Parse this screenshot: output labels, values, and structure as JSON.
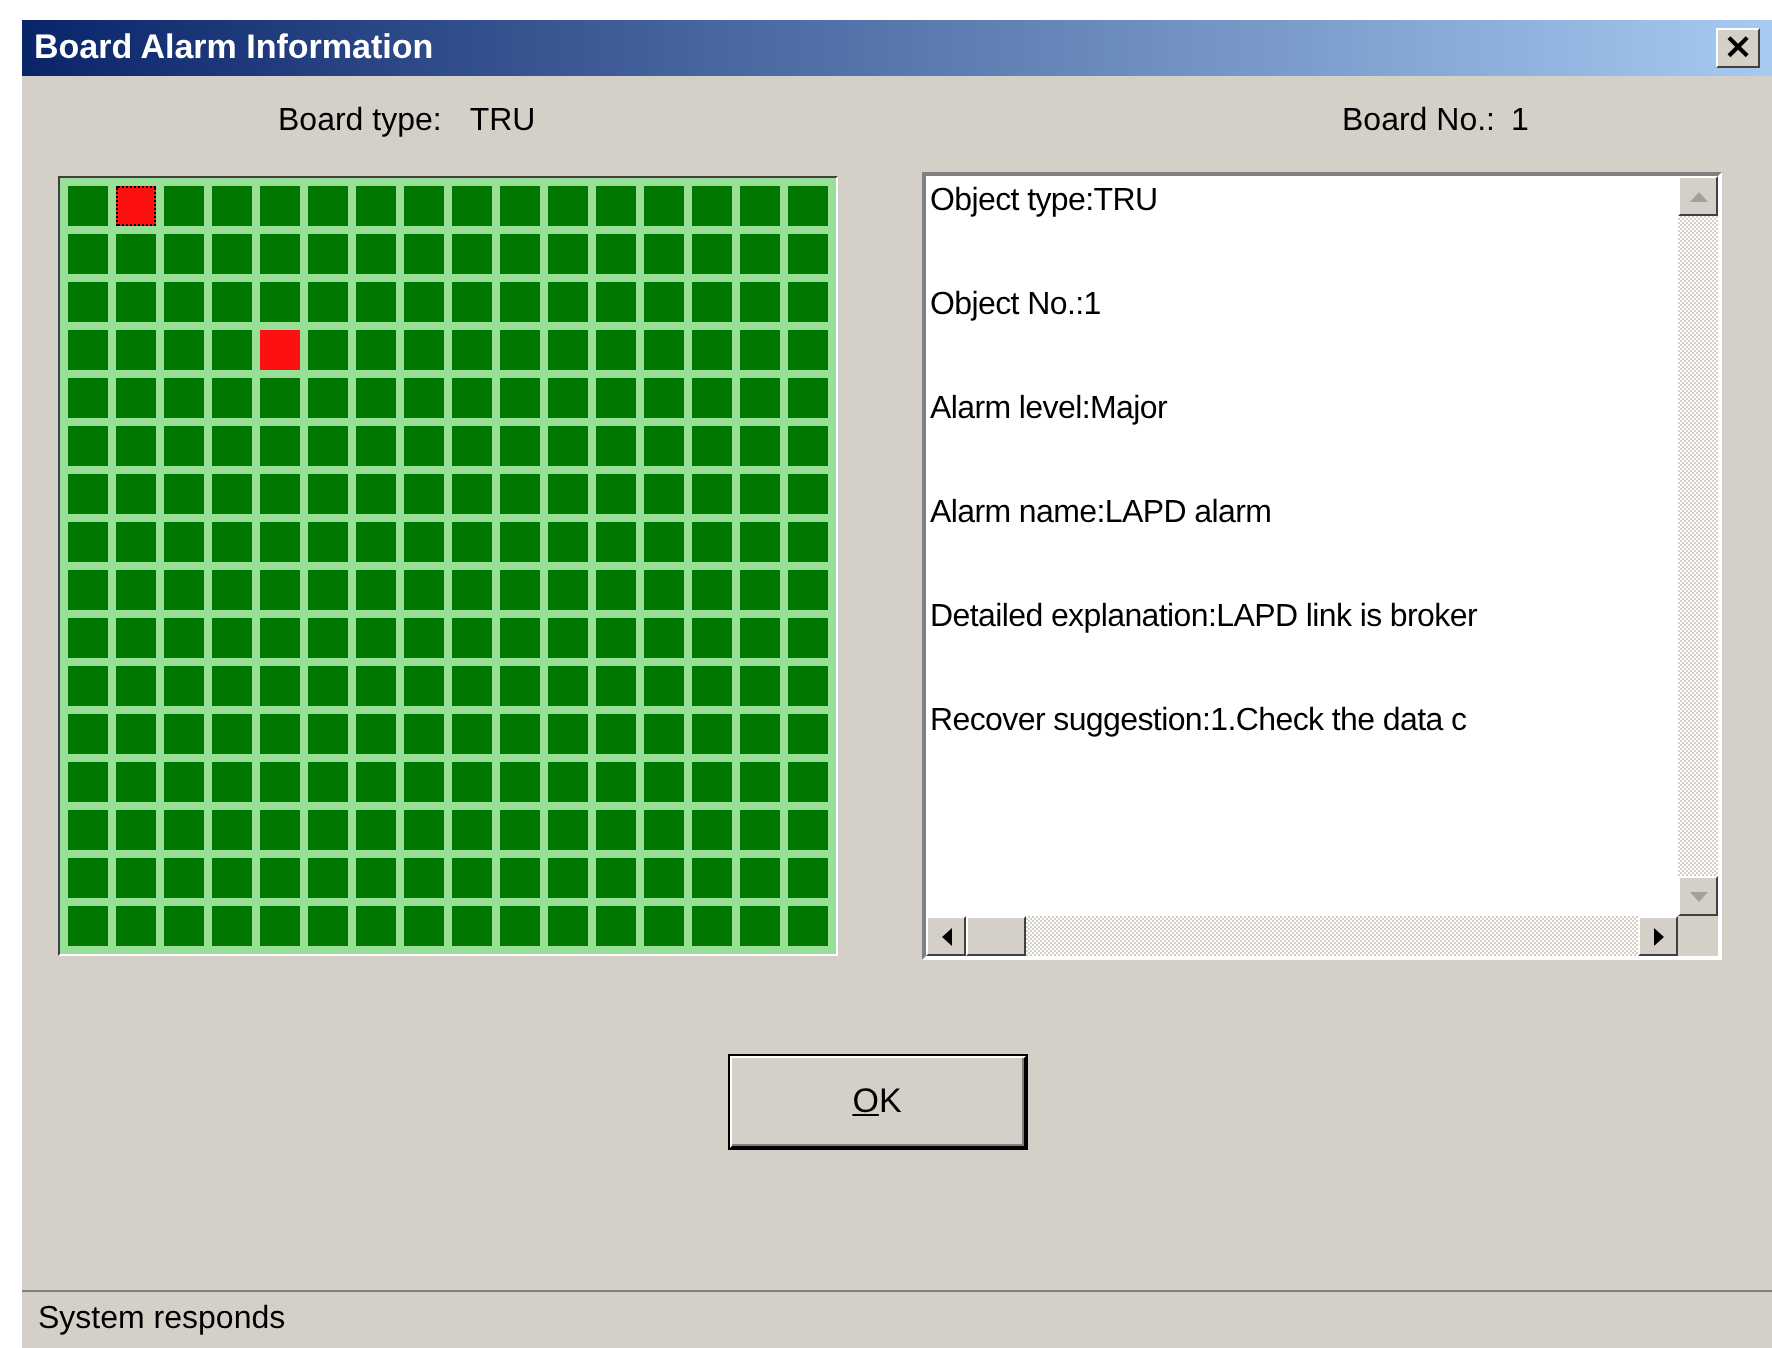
{
  "window": {
    "title": "Board Alarm Information",
    "close": "×"
  },
  "header": {
    "board_type_label": "Board type:",
    "board_type": "TRU",
    "board_no_label": "Board No.:",
    "board_no": "1"
  },
  "board_grid": {
    "rows": [
      {
        "cells": [
          {
            "alarm": false,
            "selected": false
          },
          {
            "alarm": true,
            "selected": true
          },
          {
            "alarm": false,
            "selected": false
          },
          {
            "alarm": false,
            "selected": false
          },
          {
            "alarm": false,
            "selected": false
          },
          {
            "alarm": false,
            "selected": false
          },
          {
            "alarm": false,
            "selected": false
          },
          {
            "alarm": false,
            "selected": false
          },
          {
            "alarm": false,
            "selected": false
          },
          {
            "alarm": false,
            "selected": false
          },
          {
            "alarm": false,
            "selected": false
          },
          {
            "alarm": false,
            "selected": false
          },
          {
            "alarm": false,
            "selected": false
          },
          {
            "alarm": false,
            "selected": false
          },
          {
            "alarm": false,
            "selected": false
          },
          {
            "alarm": false,
            "selected": false
          }
        ]
      },
      {
        "cells": [
          {
            "alarm": false,
            "selected": false
          },
          {
            "alarm": false,
            "selected": false
          },
          {
            "alarm": false,
            "selected": false
          },
          {
            "alarm": false,
            "selected": false
          },
          {
            "alarm": false,
            "selected": false
          },
          {
            "alarm": false,
            "selected": false
          },
          {
            "alarm": false,
            "selected": false
          },
          {
            "alarm": false,
            "selected": false
          },
          {
            "alarm": false,
            "selected": false
          },
          {
            "alarm": false,
            "selected": false
          },
          {
            "alarm": false,
            "selected": false
          },
          {
            "alarm": false,
            "selected": false
          },
          {
            "alarm": false,
            "selected": false
          },
          {
            "alarm": false,
            "selected": false
          },
          {
            "alarm": false,
            "selected": false
          },
          {
            "alarm": false,
            "selected": false
          }
        ]
      },
      {
        "cells": [
          {
            "alarm": false,
            "selected": false
          },
          {
            "alarm": false,
            "selected": false
          },
          {
            "alarm": false,
            "selected": false
          },
          {
            "alarm": false,
            "selected": false
          },
          {
            "alarm": false,
            "selected": false
          },
          {
            "alarm": false,
            "selected": false
          },
          {
            "alarm": false,
            "selected": false
          },
          {
            "alarm": false,
            "selected": false
          },
          {
            "alarm": false,
            "selected": false
          },
          {
            "alarm": false,
            "selected": false
          },
          {
            "alarm": false,
            "selected": false
          },
          {
            "alarm": false,
            "selected": false
          },
          {
            "alarm": false,
            "selected": false
          },
          {
            "alarm": false,
            "selected": false
          },
          {
            "alarm": false,
            "selected": false
          },
          {
            "alarm": false,
            "selected": false
          }
        ]
      },
      {
        "cells": [
          {
            "alarm": false,
            "selected": false
          },
          {
            "alarm": false,
            "selected": false
          },
          {
            "alarm": false,
            "selected": false
          },
          {
            "alarm": false,
            "selected": false
          },
          {
            "alarm": true,
            "selected": false
          },
          {
            "alarm": false,
            "selected": false
          },
          {
            "alarm": false,
            "selected": false
          },
          {
            "alarm": false,
            "selected": false
          },
          {
            "alarm": false,
            "selected": false
          },
          {
            "alarm": false,
            "selected": false
          },
          {
            "alarm": false,
            "selected": false
          },
          {
            "alarm": false,
            "selected": false
          },
          {
            "alarm": false,
            "selected": false
          },
          {
            "alarm": false,
            "selected": false
          },
          {
            "alarm": false,
            "selected": false
          },
          {
            "alarm": false,
            "selected": false
          }
        ]
      },
      {
        "cells": [
          {
            "alarm": false,
            "selected": false
          },
          {
            "alarm": false,
            "selected": false
          },
          {
            "alarm": false,
            "selected": false
          },
          {
            "alarm": false,
            "selected": false
          },
          {
            "alarm": false,
            "selected": false
          },
          {
            "alarm": false,
            "selected": false
          },
          {
            "alarm": false,
            "selected": false
          },
          {
            "alarm": false,
            "selected": false
          },
          {
            "alarm": false,
            "selected": false
          },
          {
            "alarm": false,
            "selected": false
          },
          {
            "alarm": false,
            "selected": false
          },
          {
            "alarm": false,
            "selected": false
          },
          {
            "alarm": false,
            "selected": false
          },
          {
            "alarm": false,
            "selected": false
          },
          {
            "alarm": false,
            "selected": false
          },
          {
            "alarm": false,
            "selected": false
          }
        ]
      },
      {
        "cells": [
          {
            "alarm": false,
            "selected": false
          },
          {
            "alarm": false,
            "selected": false
          },
          {
            "alarm": false,
            "selected": false
          },
          {
            "alarm": false,
            "selected": false
          },
          {
            "alarm": false,
            "selected": false
          },
          {
            "alarm": false,
            "selected": false
          },
          {
            "alarm": false,
            "selected": false
          },
          {
            "alarm": false,
            "selected": false
          },
          {
            "alarm": false,
            "selected": false
          },
          {
            "alarm": false,
            "selected": false
          },
          {
            "alarm": false,
            "selected": false
          },
          {
            "alarm": false,
            "selected": false
          },
          {
            "alarm": false,
            "selected": false
          },
          {
            "alarm": false,
            "selected": false
          },
          {
            "alarm": false,
            "selected": false
          },
          {
            "alarm": false,
            "selected": false
          }
        ]
      },
      {
        "cells": [
          {
            "alarm": false,
            "selected": false
          },
          {
            "alarm": false,
            "selected": false
          },
          {
            "alarm": false,
            "selected": false
          },
          {
            "alarm": false,
            "selected": false
          },
          {
            "alarm": false,
            "selected": false
          },
          {
            "alarm": false,
            "selected": false
          },
          {
            "alarm": false,
            "selected": false
          },
          {
            "alarm": false,
            "selected": false
          },
          {
            "alarm": false,
            "selected": false
          },
          {
            "alarm": false,
            "selected": false
          },
          {
            "alarm": false,
            "selected": false
          },
          {
            "alarm": false,
            "selected": false
          },
          {
            "alarm": false,
            "selected": false
          },
          {
            "alarm": false,
            "selected": false
          },
          {
            "alarm": false,
            "selected": false
          },
          {
            "alarm": false,
            "selected": false
          }
        ]
      },
      {
        "cells": [
          {
            "alarm": false,
            "selected": false
          },
          {
            "alarm": false,
            "selected": false
          },
          {
            "alarm": false,
            "selected": false
          },
          {
            "alarm": false,
            "selected": false
          },
          {
            "alarm": false,
            "selected": false
          },
          {
            "alarm": false,
            "selected": false
          },
          {
            "alarm": false,
            "selected": false
          },
          {
            "alarm": false,
            "selected": false
          },
          {
            "alarm": false,
            "selected": false
          },
          {
            "alarm": false,
            "selected": false
          },
          {
            "alarm": false,
            "selected": false
          },
          {
            "alarm": false,
            "selected": false
          },
          {
            "alarm": false,
            "selected": false
          },
          {
            "alarm": false,
            "selected": false
          },
          {
            "alarm": false,
            "selected": false
          },
          {
            "alarm": false,
            "selected": false
          }
        ]
      },
      {
        "cells": [
          {
            "alarm": false,
            "selected": false
          },
          {
            "alarm": false,
            "selected": false
          },
          {
            "alarm": false,
            "selected": false
          },
          {
            "alarm": false,
            "selected": false
          },
          {
            "alarm": false,
            "selected": false
          },
          {
            "alarm": false,
            "selected": false
          },
          {
            "alarm": false,
            "selected": false
          },
          {
            "alarm": false,
            "selected": false
          },
          {
            "alarm": false,
            "selected": false
          },
          {
            "alarm": false,
            "selected": false
          },
          {
            "alarm": false,
            "selected": false
          },
          {
            "alarm": false,
            "selected": false
          },
          {
            "alarm": false,
            "selected": false
          },
          {
            "alarm": false,
            "selected": false
          },
          {
            "alarm": false,
            "selected": false
          },
          {
            "alarm": false,
            "selected": false
          }
        ]
      },
      {
        "cells": [
          {
            "alarm": false,
            "selected": false
          },
          {
            "alarm": false,
            "selected": false
          },
          {
            "alarm": false,
            "selected": false
          },
          {
            "alarm": false,
            "selected": false
          },
          {
            "alarm": false,
            "selected": false
          },
          {
            "alarm": false,
            "selected": false
          },
          {
            "alarm": false,
            "selected": false
          },
          {
            "alarm": false,
            "selected": false
          },
          {
            "alarm": false,
            "selected": false
          },
          {
            "alarm": false,
            "selected": false
          },
          {
            "alarm": false,
            "selected": false
          },
          {
            "alarm": false,
            "selected": false
          },
          {
            "alarm": false,
            "selected": false
          },
          {
            "alarm": false,
            "selected": false
          },
          {
            "alarm": false,
            "selected": false
          },
          {
            "alarm": false,
            "selected": false
          }
        ]
      },
      {
        "cells": [
          {
            "alarm": false,
            "selected": false
          },
          {
            "alarm": false,
            "selected": false
          },
          {
            "alarm": false,
            "selected": false
          },
          {
            "alarm": false,
            "selected": false
          },
          {
            "alarm": false,
            "selected": false
          },
          {
            "alarm": false,
            "selected": false
          },
          {
            "alarm": false,
            "selected": false
          },
          {
            "alarm": false,
            "selected": false
          },
          {
            "alarm": false,
            "selected": false
          },
          {
            "alarm": false,
            "selected": false
          },
          {
            "alarm": false,
            "selected": false
          },
          {
            "alarm": false,
            "selected": false
          },
          {
            "alarm": false,
            "selected": false
          },
          {
            "alarm": false,
            "selected": false
          },
          {
            "alarm": false,
            "selected": false
          },
          {
            "alarm": false,
            "selected": false
          }
        ]
      },
      {
        "cells": [
          {
            "alarm": false,
            "selected": false
          },
          {
            "alarm": false,
            "selected": false
          },
          {
            "alarm": false,
            "selected": false
          },
          {
            "alarm": false,
            "selected": false
          },
          {
            "alarm": false,
            "selected": false
          },
          {
            "alarm": false,
            "selected": false
          },
          {
            "alarm": false,
            "selected": false
          },
          {
            "alarm": false,
            "selected": false
          },
          {
            "alarm": false,
            "selected": false
          },
          {
            "alarm": false,
            "selected": false
          },
          {
            "alarm": false,
            "selected": false
          },
          {
            "alarm": false,
            "selected": false
          },
          {
            "alarm": false,
            "selected": false
          },
          {
            "alarm": false,
            "selected": false
          },
          {
            "alarm": false,
            "selected": false
          },
          {
            "alarm": false,
            "selected": false
          }
        ]
      },
      {
        "cells": [
          {
            "alarm": false,
            "selected": false
          },
          {
            "alarm": false,
            "selected": false
          },
          {
            "alarm": false,
            "selected": false
          },
          {
            "alarm": false,
            "selected": false
          },
          {
            "alarm": false,
            "selected": false
          },
          {
            "alarm": false,
            "selected": false
          },
          {
            "alarm": false,
            "selected": false
          },
          {
            "alarm": false,
            "selected": false
          },
          {
            "alarm": false,
            "selected": false
          },
          {
            "alarm": false,
            "selected": false
          },
          {
            "alarm": false,
            "selected": false
          },
          {
            "alarm": false,
            "selected": false
          },
          {
            "alarm": false,
            "selected": false
          },
          {
            "alarm": false,
            "selected": false
          },
          {
            "alarm": false,
            "selected": false
          },
          {
            "alarm": false,
            "selected": false
          }
        ]
      },
      {
        "cells": [
          {
            "alarm": false,
            "selected": false
          },
          {
            "alarm": false,
            "selected": false
          },
          {
            "alarm": false,
            "selected": false
          },
          {
            "alarm": false,
            "selected": false
          },
          {
            "alarm": false,
            "selected": false
          },
          {
            "alarm": false,
            "selected": false
          },
          {
            "alarm": false,
            "selected": false
          },
          {
            "alarm": false,
            "selected": false
          },
          {
            "alarm": false,
            "selected": false
          },
          {
            "alarm": false,
            "selected": false
          },
          {
            "alarm": false,
            "selected": false
          },
          {
            "alarm": false,
            "selected": false
          },
          {
            "alarm": false,
            "selected": false
          },
          {
            "alarm": false,
            "selected": false
          },
          {
            "alarm": false,
            "selected": false
          },
          {
            "alarm": false,
            "selected": false
          }
        ]
      },
      {
        "cells": [
          {
            "alarm": false,
            "selected": false
          },
          {
            "alarm": false,
            "selected": false
          },
          {
            "alarm": false,
            "selected": false
          },
          {
            "alarm": false,
            "selected": false
          },
          {
            "alarm": false,
            "selected": false
          },
          {
            "alarm": false,
            "selected": false
          },
          {
            "alarm": false,
            "selected": false
          },
          {
            "alarm": false,
            "selected": false
          },
          {
            "alarm": false,
            "selected": false
          },
          {
            "alarm": false,
            "selected": false
          },
          {
            "alarm": false,
            "selected": false
          },
          {
            "alarm": false,
            "selected": false
          },
          {
            "alarm": false,
            "selected": false
          },
          {
            "alarm": false,
            "selected": false
          },
          {
            "alarm": false,
            "selected": false
          },
          {
            "alarm": false,
            "selected": false
          }
        ]
      },
      {
        "cells": [
          {
            "alarm": false,
            "selected": false
          },
          {
            "alarm": false,
            "selected": false
          },
          {
            "alarm": false,
            "selected": false
          },
          {
            "alarm": false,
            "selected": false
          },
          {
            "alarm": false,
            "selected": false
          },
          {
            "alarm": false,
            "selected": false
          },
          {
            "alarm": false,
            "selected": false
          },
          {
            "alarm": false,
            "selected": false
          },
          {
            "alarm": false,
            "selected": false
          },
          {
            "alarm": false,
            "selected": false
          },
          {
            "alarm": false,
            "selected": false
          },
          {
            "alarm": false,
            "selected": false
          },
          {
            "alarm": false,
            "selected": false
          },
          {
            "alarm": false,
            "selected": false
          },
          {
            "alarm": false,
            "selected": false
          },
          {
            "alarm": false,
            "selected": false
          }
        ]
      }
    ]
  },
  "details": {
    "lines": [
      "Object type:TRU",
      "Object No.:1",
      "Alarm level:Major",
      "Alarm name:LAPD alarm",
      "Detailed explanation:LAPD link is broker",
      "Recover suggestion:1.Check the data c"
    ]
  },
  "buttons": [
    {
      "label": "OK"
    }
  ],
  "status_bar": {
    "text": "System responds"
  }
}
